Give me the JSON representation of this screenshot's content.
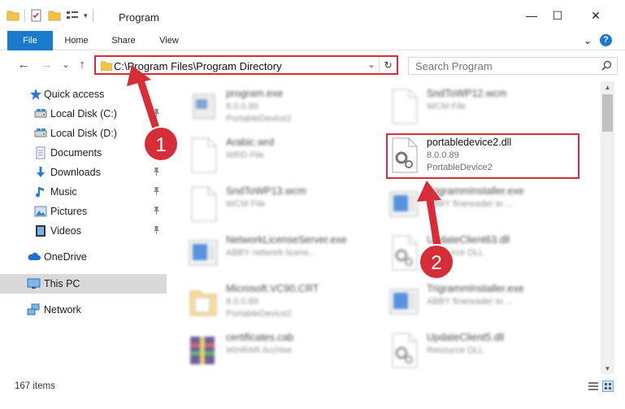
{
  "window": {
    "title": "Program",
    "minimize": "—",
    "maximize": "☐",
    "close": "✕"
  },
  "ribbon": {
    "tabs": [
      "File",
      "Home",
      "Share",
      "View"
    ],
    "expand": "⌄",
    "help": "?"
  },
  "nav": {
    "back": "←",
    "forward": "→",
    "recent": "⌄",
    "up": "↑"
  },
  "address": {
    "path": "C:\\Program Files\\Program Directory",
    "dropdown": "⌄",
    "refresh": "↻"
  },
  "search": {
    "placeholder": "Search Program"
  },
  "sidebar": {
    "items": [
      {
        "label": "Quick access",
        "icon": "star-icon",
        "pinned": false
      },
      {
        "label": "Local Disk (C:)",
        "icon": "drive-icon",
        "pinned": true
      },
      {
        "label": "Local Disk (D:)",
        "icon": "drive-icon",
        "pinned": true
      },
      {
        "label": "Documents",
        "icon": "document-icon",
        "pinned": true
      },
      {
        "label": "Downloads",
        "icon": "download-icon",
        "pinned": true
      },
      {
        "label": "Music",
        "icon": "music-icon",
        "pinned": true
      },
      {
        "label": "Pictures",
        "icon": "picture-icon",
        "pinned": true
      },
      {
        "label": "Videos",
        "icon": "video-icon",
        "pinned": true
      },
      {
        "label": "OneDrive",
        "icon": "cloud-icon",
        "pinned": false
      },
      {
        "label": "This PC",
        "icon": "computer-icon",
        "pinned": false
      },
      {
        "label": "Network",
        "icon": "network-icon",
        "pinned": false
      }
    ],
    "pin_glyph": "📌"
  },
  "files": [
    {
      "name": "program.exe",
      "line2": "8.0.0.89",
      "line3": "PortableDevice2",
      "icon": "exe-icon",
      "blurred": true
    },
    {
      "name": "SndToWP12.wcm",
      "line2": "WCM File",
      "line3": "",
      "icon": "blank-file-icon",
      "blurred": true
    },
    {
      "name": "Arabic.wrd",
      "line2": "WRD File",
      "line3": "",
      "icon": "blank-file-icon",
      "blurred": true
    },
    {
      "name": "portabledevice2.dll",
      "line2": "8.0.0.89",
      "line3": "PortableDevice2",
      "icon": "dll-gear-icon",
      "blurred": false
    },
    {
      "name": "SndToWP13.wcm",
      "line2": "WCM File",
      "line3": "",
      "icon": "blank-file-icon",
      "blurred": true
    },
    {
      "name": "TrigrammInstaller.exe",
      "line2": "ABBY finereader to ...",
      "line3": "",
      "icon": "installer-icon",
      "blurred": true
    },
    {
      "name": "NetworkLicenseServer.exe",
      "line2": "ABBY network licens...",
      "line3": "",
      "icon": "installer-icon",
      "blurred": true
    },
    {
      "name": "UpdateClient63.dll",
      "line2": "Resource DLL",
      "line3": "",
      "icon": "dll-gear-icon",
      "blurred": true
    },
    {
      "name": "Microsoft.VC90.CRT",
      "line2": "8.0.0.89",
      "line3": "PortableDevice2",
      "icon": "folder-file-icon",
      "blurred": true
    },
    {
      "name": "TrigrammInstaller.exe",
      "line2": "ABBY finereader to ...",
      "line3": "",
      "icon": "installer-icon",
      "blurred": true
    },
    {
      "name": "certificates.cab",
      "line2": "WinRAR Archive",
      "line3": "",
      "icon": "archive-icon",
      "blurred": true
    },
    {
      "name": "UpdateClient5.dll",
      "line2": "Resource DLL",
      "line3": "",
      "icon": "dll-gear-icon",
      "blurred": true
    }
  ],
  "status": {
    "item_count": "167 items"
  },
  "annotations": {
    "step1": "1",
    "step2": "2",
    "color": "#d62e38"
  }
}
